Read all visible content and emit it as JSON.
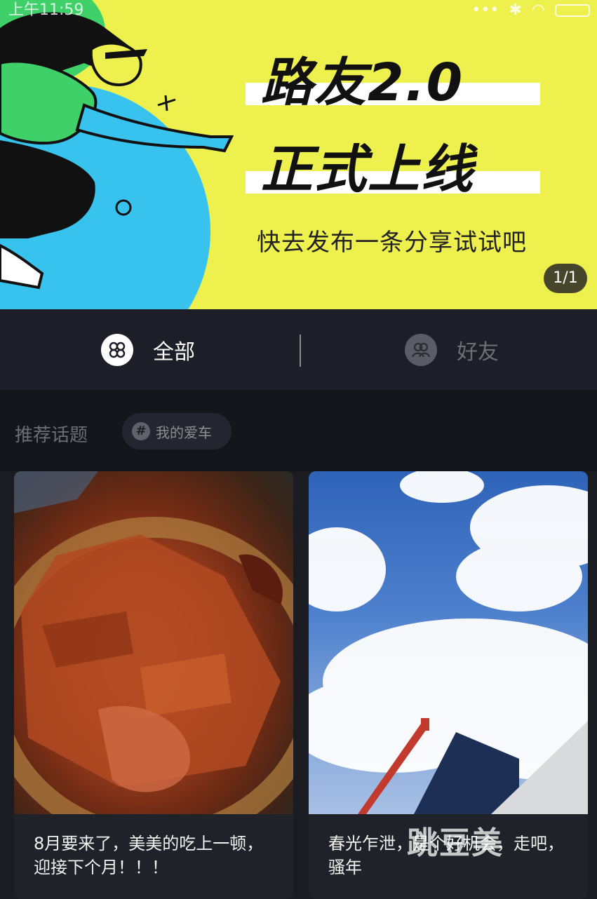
{
  "status_bar": {
    "time": "上午11:59",
    "signal_dots": "•••"
  },
  "banner": {
    "headline_line1": "路友2.0",
    "headline_line2": "正式上线",
    "subline": "快去发布一条分享试试吧",
    "pager": "1/1",
    "colors": {
      "background": "#eef04e",
      "circle": "#38c3ee",
      "blob": "#3fd06a"
    }
  },
  "tabs": [
    {
      "label": "全部",
      "icon": "grid-clover-icon",
      "active": true
    },
    {
      "label": "好友",
      "icon": "friends-icon",
      "active": false
    }
  ],
  "topics": {
    "label": "推荐话题",
    "chips": [
      {
        "hash": "#",
        "text": "我的爱车"
      }
    ]
  },
  "feed": [
    {
      "image": "roast-duck-photo",
      "caption": "8月要来了，美美的吃上一顿，迎接下个月！！！"
    },
    {
      "image": "sky-crane-photo",
      "caption": "春光乍泄，是个好机会，走吧，骚年"
    }
  ],
  "watermark": "跳豆美"
}
